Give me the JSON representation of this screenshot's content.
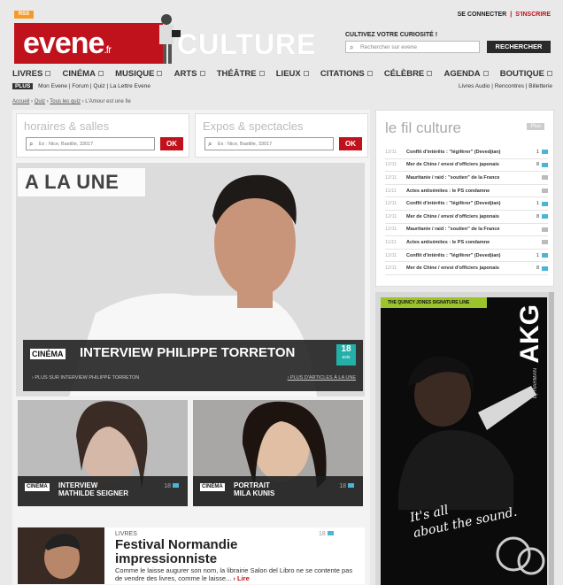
{
  "top": {
    "rss_label": "RSS",
    "login": "SE CONNECTER",
    "register": "S'INSCRIRE"
  },
  "header": {
    "logo_main": "evene",
    "logo_tld": ".fr",
    "culture_word": "CULTURE",
    "tagline": "CULTIVEZ VOTRE CURIOSITÉ !",
    "search_placeholder": "Rechercher sur evene",
    "search_button": "RECHERCHER"
  },
  "nav": {
    "items": [
      "LIVRES",
      "CINÉMA",
      "MUSIQUE",
      "ARTS",
      "THÉÂTRE",
      "LIEUX",
      "CITATIONS",
      "CÉLÈBRE",
      "AGENDA",
      "BOUTIQUE"
    ]
  },
  "subnav": {
    "badge": "PLUS",
    "left": "Mon Evene | Forum | Quiz | La Lettre Evene",
    "right": "Livres Audio | Rencontres | Billetterie"
  },
  "breadcrumb": {
    "home": "Accueil",
    "quiz": "Quiz",
    "all_quiz": "Tous les quiz",
    "current": "L'Amour est une île"
  },
  "panels": {
    "horaires": {
      "title": "horaires & salles",
      "placeholder": "Ex : Nice, Bastille, 33017",
      "ok": "OK"
    },
    "expos": {
      "title": "Expos & spectacles",
      "placeholder": "Ex : Nice, Bastille, 33017",
      "ok": "OK"
    }
  },
  "une": {
    "label": "A LA UNE",
    "tag": "CINÉMA",
    "title": "INTERVIEW PHILIPPE TORRETON",
    "count": "18",
    "count_label": "avis",
    "link_more": "› PLUS SUR INTERVIEW PHILIPPE TORRETON",
    "link_articles": "› PLUS D'ARTICLES À LA UNE"
  },
  "cards": [
    {
      "tag": "CINÉMA",
      "line1": "INTERVIEW",
      "line2": "MATHILDE SEIGNER",
      "count": "18"
    },
    {
      "tag": "CINÉMA",
      "line1": "PORTRAIT",
      "line2": "MILA KUNIS",
      "count": "18"
    }
  ],
  "article": {
    "category": "LIVRES",
    "title": "Festival Normandie impressionniste",
    "text": "Comme le laisse augurer son nom, la librairie Salon del Libro ne se contente pas de vendre des livres, comme le laisse...",
    "lire": "› Lire",
    "count": "18"
  },
  "fil": {
    "title": "le fil culture",
    "plus": "Plus",
    "rows": [
      {
        "date": "12/11",
        "text": "Conflit d'intérêts : \"légifèrer\" (Devedjian)",
        "count": "1",
        "bubble": "blue"
      },
      {
        "date": "12/11",
        "text": "Mer de Chine / envoi d'officiers japonais",
        "count": "8",
        "bubble": "blue"
      },
      {
        "date": "12/11",
        "text": "Mauritanie / raid : \"soutien\" de la France",
        "count": "",
        "bubble": "grey"
      },
      {
        "date": "11/11",
        "text": "Actes antisémites : le PS condamne",
        "count": "",
        "bubble": "grey"
      },
      {
        "date": "12/11",
        "text": "Conflit d'intérêts : \"légifèrer\" (Devedjian)",
        "count": "1",
        "bubble": "blue"
      },
      {
        "date": "12/11",
        "text": "Mer de Chine / envoi d'officiers japonais",
        "count": "8",
        "bubble": "blue"
      },
      {
        "date": "12/11",
        "text": "Mauritanie / raid : \"soutien\" de la France",
        "count": "",
        "bubble": "grey"
      },
      {
        "date": "11/11",
        "text": "Actes antisémites : le PS condamne",
        "count": "",
        "bubble": "grey"
      },
      {
        "date": "12/11",
        "text": "Conflit d'intérêts : \"légifèrer\" (Devedjian)",
        "count": "1",
        "bubble": "blue"
      },
      {
        "date": "12/11",
        "text": "Mer de Chine / envoi d'officiers japonais",
        "count": "8",
        "bubble": "blue"
      }
    ]
  },
  "ad": {
    "banner": "THE QUINCY JONES SIGNATURE LINE",
    "brand": "AKG",
    "by": "by HARMAN",
    "script_line1": "It's all",
    "script_line2": "about the sound."
  },
  "colors": {
    "brand_red": "#c0121c",
    "teal": "#23b0a8",
    "comment_blue": "#49b6d6",
    "ad_green": "#9bc32a"
  }
}
